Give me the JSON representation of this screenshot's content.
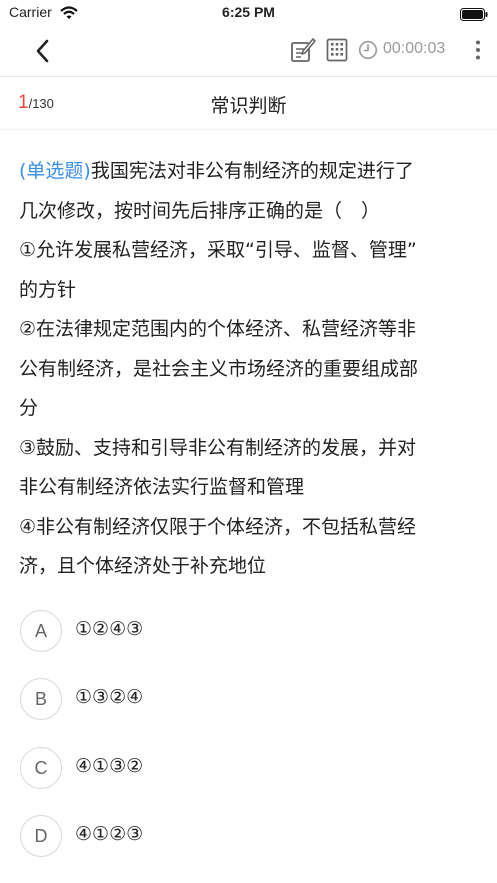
{
  "status_bar": {
    "carrier": "Carrier",
    "time": "6:25 PM",
    "icons": [
      "wifi-icon",
      "battery-icon"
    ]
  },
  "nav": {
    "icons": [
      "back-arrow-icon",
      "notes-icon",
      "answer-sheet-icon",
      "clock-icon",
      "more-icon"
    ],
    "timer": "00:00:03"
  },
  "header": {
    "current": "1",
    "total": "/130",
    "title": "常识判断"
  },
  "question": {
    "type_label": "(单选题)",
    "lines": [
      "我国宪法对非公有制经济的规定进行了",
      "几次修改，按时间先后排序正确的是（　）",
      "①允许发展私营经济，采取“引导、监督、管理”",
      "的方针",
      "②在法律规定范围内的个体经济、私营经济等非",
      "公有制经济，是社会主义市场经济的重要组成部",
      "分",
      "③鼓励、支持和引导非公有制经济的发展，并对",
      "非公有制经济依法实行监督和管理",
      "④非公有制经济仅限于个体经济，不包括私营经",
      "济，且个体经济处于补充地位"
    ]
  },
  "options": [
    {
      "letter": "A",
      "text": "①②④③"
    },
    {
      "letter": "B",
      "text": "①③②④"
    },
    {
      "letter": "C",
      "text": "④①③②"
    },
    {
      "letter": "D",
      "text": "④①②③"
    }
  ]
}
